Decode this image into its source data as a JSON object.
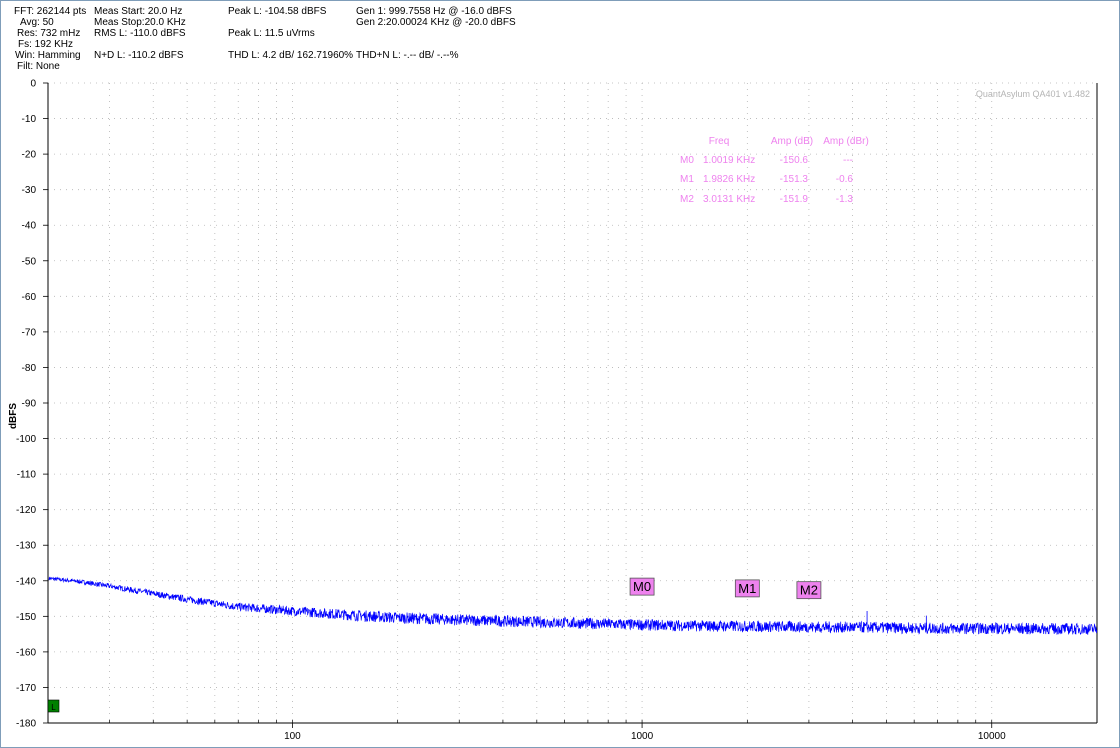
{
  "header": {
    "col1": [
      "FFT: 262144 pts",
      "Avg: 50",
      "Res: 732 mHz",
      "Fs: 192 KHz",
      "Win: Hamming",
      "Filt: None"
    ],
    "col2": [
      "Meas Start: 20.0 Hz",
      "Meas Stop:20.0 KHz",
      "RMS L: -110.0 dBFS",
      "",
      "N+D L: -110.2 dBFS"
    ],
    "col3": [
      "Peak L: -104.58 dBFS",
      "",
      "Peak L: 11.5 uVrms",
      "",
      "THD L: 4.2 dB/ 162.71960%"
    ],
    "col4": [
      "Gen 1: 999.7558 Hz @ -16.0  dBFS",
      "Gen 2:20.00024 KHz @ -20.0  dBFS",
      "",
      "",
      "THD+N L: -.-- dB/ -.--%"
    ]
  },
  "watermark": "QuantAsylum QA401 v1.482",
  "marker_table": {
    "headers": [
      "Freq",
      "Amp (dB)",
      "Amp (dBr)"
    ],
    "rows": [
      {
        "id": "M0",
        "freq": "1.0019 KHz",
        "amp": "-150.6",
        "dbr": "---"
      },
      {
        "id": "M1",
        "freq": "1.9826 KHz",
        "amp": "-151.3",
        "dbr": "-0.6"
      },
      {
        "id": "M2",
        "freq": "3.0131 KHz",
        "amp": "-151.9",
        "dbr": "-1.3"
      }
    ]
  },
  "colors": {
    "trace": "#0000ff",
    "marker_fill": "#ee82ee",
    "marker_text": "#ee82ee",
    "grid": "#b4b4b4",
    "frame": "#7f9db9",
    "channel_badge": "#008000"
  },
  "channel_badge": "L",
  "chart_data": {
    "type": "line",
    "title": "",
    "xlabel": "",
    "ylabel": "dBFS",
    "x_scale": "log",
    "xlim": [
      20,
      20000
    ],
    "ylim": [
      -180,
      0
    ],
    "x_ticks": [
      100,
      1000,
      10000
    ],
    "x_tick_labels": [
      "100",
      "1000",
      "10000"
    ],
    "y_ticks": [
      0,
      -10,
      -20,
      -30,
      -40,
      -50,
      -60,
      -70,
      -80,
      -90,
      -100,
      -110,
      -120,
      -130,
      -140,
      -150,
      -160,
      -170,
      -180
    ],
    "y_tick_labels": [
      "0",
      "-10",
      "-20",
      "-30",
      "-40",
      "-50",
      "-60",
      "-70",
      "-80",
      "-90",
      "-100",
      "-110",
      "-120",
      "-130",
      "-140",
      "-150",
      "-160",
      "-170",
      "-180"
    ],
    "grid": true,
    "series": [
      {
        "x": [
          20,
          25,
          30,
          40,
          50,
          70,
          100,
          150,
          200,
          300,
          500,
          700,
          1000,
          1500,
          2000,
          3000,
          4000,
          4400,
          5000,
          6000,
          6500,
          7000,
          8000,
          10000,
          15000,
          20000
        ],
        "y": [
          -139.3,
          -140.3,
          -141.5,
          -143.6,
          -145.2,
          -147.3,
          -148.5,
          -149.7,
          -150.4,
          -151.0,
          -151.6,
          -152.0,
          -152.4,
          -152.7,
          -152.8,
          -153.0,
          -153.1,
          -153.1,
          -153.2,
          -153.3,
          -153.3,
          -153.4,
          -153.4,
          -153.4,
          -153.5,
          -153.6
        ]
      }
    ],
    "spurs": [
      {
        "x": 4400,
        "y": -148.5
      },
      {
        "x": 6500,
        "y": -149.8
      }
    ],
    "markers": [
      {
        "label": "M0",
        "x": 1000,
        "y": -141.5
      },
      {
        "label": "M1",
        "x": 2000,
        "y": -142.0
      },
      {
        "label": "M2",
        "x": 3000,
        "y": -142.5
      }
    ]
  }
}
